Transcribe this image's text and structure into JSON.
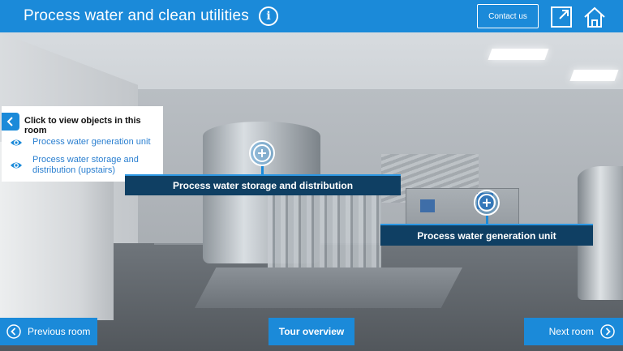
{
  "header": {
    "title": "Process water and clean utilities",
    "info_icon": "info-icon",
    "contact_label": "Contact us",
    "fullscreen_icon": "fullscreen-icon",
    "home_icon": "home-icon"
  },
  "panel": {
    "title": "Click to view objects in this room",
    "toggle_icon": "chevron-left-icon",
    "items": [
      {
        "label": "Process water generation unit",
        "icon": "eye-icon"
      },
      {
        "label": "Process water storage and distribution (upstairs)",
        "icon": "eye-icon"
      }
    ]
  },
  "hotspots": [
    {
      "label": "Process water storage and distribution",
      "icon": "plus-circle-icon"
    },
    {
      "label": "Process water generation unit",
      "icon": "plus-circle-icon"
    }
  ],
  "footer": {
    "prev_label": "Previous room",
    "tour_label": "Tour overview",
    "next_label": "Next room"
  },
  "colors": {
    "brand_blue": "#1b8ad9",
    "label_navy": "#0f3f63"
  }
}
